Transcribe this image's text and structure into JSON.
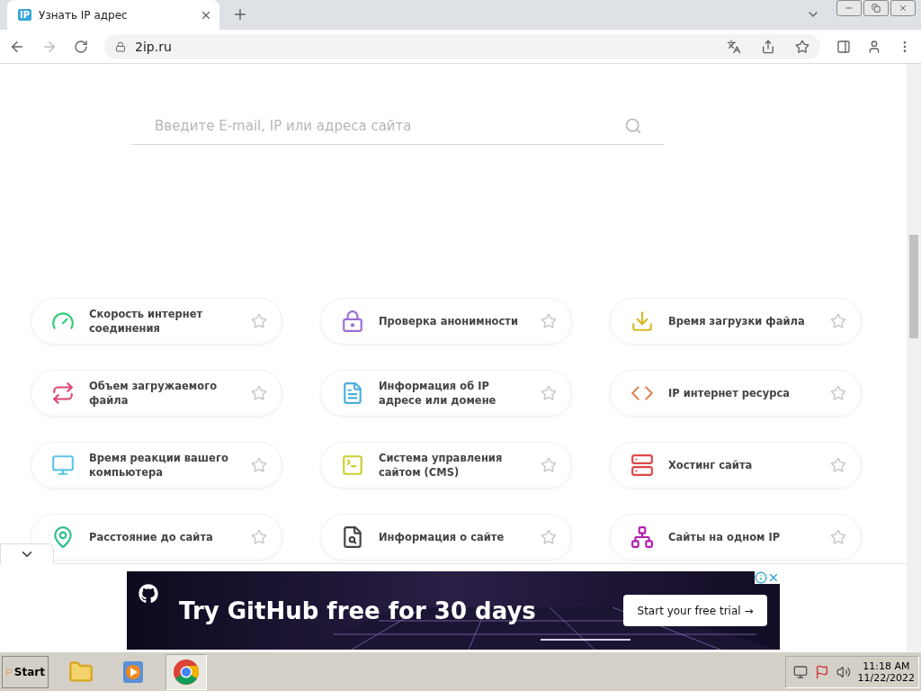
{
  "browser": {
    "tab": {
      "favicon": "IP",
      "title": "Узнать IP адрес",
      "selected": true
    },
    "address": "2ip.ru"
  },
  "search": {
    "placeholder": "Введите E-mail, IP или адреса сайта"
  },
  "services": [
    {
      "title": "Скорость интернет соединения",
      "color": "#2ecc71",
      "favorite": false
    },
    {
      "title": "Проверка анонимности",
      "color": "#9b6fd6",
      "favorite": false
    },
    {
      "title": "Время загрузки файла",
      "color": "#d9b825",
      "favorite": false
    },
    {
      "title": "Объем загружаемого файла",
      "color": "#e0456e",
      "favorite": false
    },
    {
      "title": "Информация об IP адресе или домене",
      "color": "#4aaed9",
      "favorite": false
    },
    {
      "title": "IP интернет ресурса",
      "color": "#e0895a",
      "favorite": false
    },
    {
      "title": "Время реакции вашего компьютера",
      "color": "#5cc6e8",
      "favorite": false
    },
    {
      "title": "Система управления сайтом (CMS)",
      "color": "#c9d132",
      "favorite": false
    },
    {
      "title": "Хостинг сайта",
      "color": "#e04848",
      "favorite": false
    },
    {
      "title": "Расстояние до сайта",
      "color": "#2fbf86",
      "favorite": false
    },
    {
      "title": "Информация о сайте",
      "color": "#444444",
      "favorite": false
    },
    {
      "title": "Сайты на одном IP",
      "color": "#b31fae",
      "favorite": false
    }
  ],
  "ad": {
    "headline": "Try GitHub free for 30 days",
    "button": "Start your free trial →"
  },
  "taskbar": {
    "start": "Start",
    "time": "11:18 AM",
    "date": "11/22/2022"
  }
}
